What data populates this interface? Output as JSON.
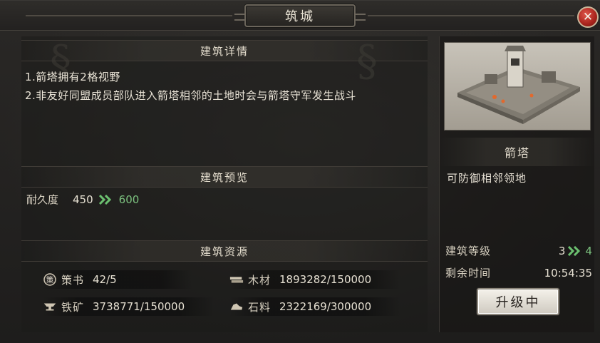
{
  "window": {
    "title": "筑城",
    "close_label": "✕"
  },
  "details": {
    "header": "建筑详情",
    "line1": "1.箭塔拥有2格视野",
    "line2": "2.非友好同盟成员部队进入箭塔相邻的土地时会与箭塔守军发生战斗"
  },
  "preview": {
    "header": "建筑预览",
    "durability_label": "耐久度",
    "durability_current": "450",
    "durability_next": "600"
  },
  "resources": {
    "header": "建筑资源",
    "items": [
      {
        "label": "策书",
        "value": "42/5",
        "icon": "scroll-icon"
      },
      {
        "label": "木材",
        "value": "1893282/150000",
        "icon": "wood-icon"
      },
      {
        "label": "铁矿",
        "value": "3738771/150000",
        "icon": "anvil-icon"
      },
      {
        "label": "石料",
        "value": "2322169/300000",
        "icon": "stone-icon"
      }
    ]
  },
  "building": {
    "name": "箭塔",
    "description": "可防御相邻领地",
    "level_label": "建筑等级",
    "level_current": "3",
    "level_next": "4",
    "time_label": "剩余时间",
    "time_value": "10:54:35",
    "upgrade_button": "升级中"
  },
  "colors": {
    "next_value": "#7cc27f",
    "close_button": "#b52a20",
    "panel_bg": "#1e1d1c"
  }
}
